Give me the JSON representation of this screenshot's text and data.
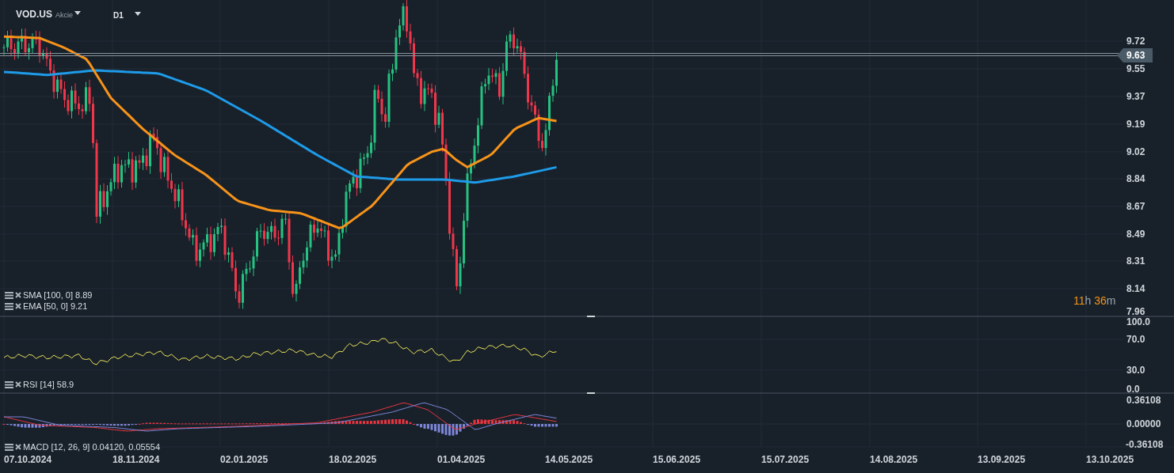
{
  "symbol": {
    "ticker": "VOD.US",
    "type": "Akcie"
  },
  "timeframe": "D1",
  "price_axis": {
    "ticks": [
      "9.72",
      "9.55",
      "9.37",
      "9.19",
      "9.02",
      "8.84",
      "8.67",
      "8.49",
      "8.31",
      "8.14",
      "7.96"
    ],
    "current": "9.63"
  },
  "countdown": {
    "hours": "11",
    "hours_unit": "h",
    "minutes": "36",
    "minutes_unit": "m"
  },
  "indicators": [
    {
      "label": "SMA [100, 0] 8.89",
      "color": "#1e9be9"
    },
    {
      "label": "EMA [50, 0] 9.21",
      "color": "#f7931a"
    }
  ],
  "rsi": {
    "ticks": [
      "100.0",
      "70.0",
      "30.0",
      "0.0"
    ],
    "legend": "RSI [14] 58.9",
    "color": "#e8e05a"
  },
  "macd": {
    "ticks": [
      "0.36108",
      "0.00000",
      "-0.36108"
    ],
    "legend": "MACD [12, 26, 9] 0.04120, 0.05554"
  },
  "dates": [
    "07.10.2024",
    "18.11.2024",
    "02.01.2025",
    "18.02.2025",
    "01.04.2025",
    "14.05.2025",
    "15.06.2025",
    "15.07.2025",
    "14.08.2025",
    "13.09.2025",
    "13.10.2025"
  ]
}
